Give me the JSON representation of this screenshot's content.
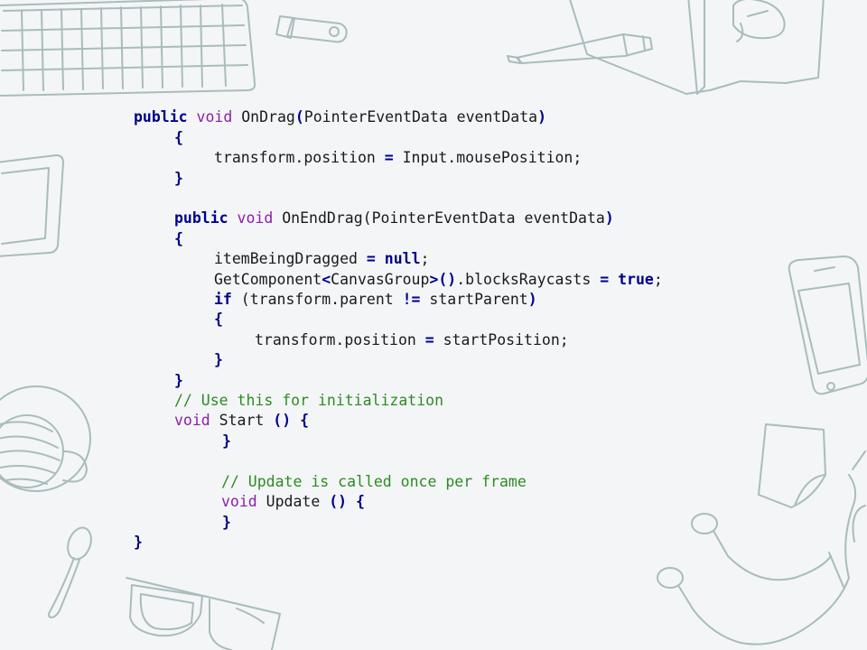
{
  "code": {
    "lines": [
      [
        "public",
        " ",
        "void",
        " OnDrag",
        "(",
        "PointerEventData eventData",
        ")"
      ],
      [
        "{"
      ],
      [
        "transform.position ",
        "=",
        " Input.mousePosition;"
      ],
      [
        "}"
      ],
      [
        "public",
        " ",
        "void",
        " OnEndDrag(PointerEventData eventData",
        ")"
      ],
      [
        "{"
      ],
      [
        "itemBeingDragged ",
        "=",
        " ",
        "null",
        ";"
      ],
      [
        "GetComponent",
        "<",
        "CanvasGroup",
        ">",
        "()",
        ".blocksRaycasts ",
        "=",
        " ",
        "true",
        ";"
      ],
      [
        "if",
        " (transform.parent ",
        "!=",
        " startParent",
        ")"
      ],
      [
        "{"
      ],
      [
        "transform.position ",
        "=",
        " startPosition;"
      ],
      [
        "}"
      ],
      [
        "}"
      ],
      [
        "// Use this for initialization"
      ],
      [
        "void",
        " Start ",
        "()",
        " ",
        "{"
      ],
      [
        "}"
      ],
      [
        "// Update is called once per frame"
      ],
      [
        "void",
        " Update ",
        "()",
        " ",
        "{"
      ],
      [
        "}"
      ],
      [
        "}"
      ]
    ]
  },
  "decorations": [
    "keyboard-sketch",
    "usb-drive-sketch",
    "marker-sketch",
    "notebook-sketch",
    "tablet-sketch",
    "smartphone-sketch",
    "coffee-cup-sketch",
    "spoon-sketch",
    "glasses-sketch",
    "sticky-note-sketch",
    "earphones-sketch"
  ]
}
